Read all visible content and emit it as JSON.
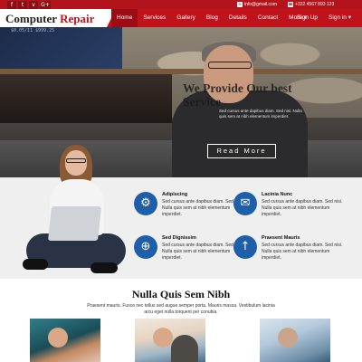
{
  "topbar": {
    "social": [
      {
        "icon": "facebook-icon",
        "glyph": "f"
      },
      {
        "icon": "twitter-icon",
        "glyph": "t"
      },
      {
        "icon": "vk-icon",
        "glyph": "v"
      },
      {
        "icon": "google-plus-icon",
        "glyph": "G+"
      }
    ],
    "email": "info@gmail.com",
    "phone": "+322 4567 893 123"
  },
  "header": {
    "brand_part1": "Computer",
    "brand_part2": "Repair",
    "nav": [
      "Home",
      "Services",
      "Gallery",
      "Blog",
      "Details",
      "Contact",
      "More ▾"
    ],
    "active_index": 0,
    "signup": "Sign Up",
    "signin": "Sign in ▾"
  },
  "hero": {
    "monitor_text": "$0.05/11  $999.25",
    "title": "We Provide Our best Service",
    "text": "Sed cursus ante dapibus diam. Sed nisi. Nulla quis sem at nibh elementum imperdiet.",
    "button": "Read More"
  },
  "features": [
    {
      "icon": "gear-icon",
      "glyph": "⚙",
      "title": "Adipiscing",
      "text": "Sed cursus ante dapibus diam. Sed nisi. Nulla quis sem at nibh elementum imperdiet."
    },
    {
      "icon": "envelope-icon",
      "glyph": "✉",
      "title": "Lacinia Nunc",
      "text": "Sed cursus ante dapibus diam. Sed nisi. Nulla quis sem at nibh elementum imperdiet."
    },
    {
      "icon": "globe-icon",
      "glyph": "⊕",
      "title": "Sed Dignissim",
      "text": "Sed cursus ante dapibus diam. Sed nisi. Nulla quis sem at nibh elementum imperdiet."
    },
    {
      "icon": "rocket-icon",
      "glyph": "↑",
      "title": "Praesent Mauris",
      "text": "Sed cursus ante dapibus diam. Sed nisi. Nulla quis sem at nibh elementum imperdiet."
    }
  ],
  "section": {
    "title": "Nulla Quis Sem Nibh",
    "subtitle": "Praesent mauris. Fusce nec tellus sed augue semper porta. Mauris massa. Vestibulum lacinia arcu eget nulla.torquent per conubia."
  },
  "colors": {
    "accent": "#c0121b",
    "feature_icon": "#1f5ea8"
  }
}
